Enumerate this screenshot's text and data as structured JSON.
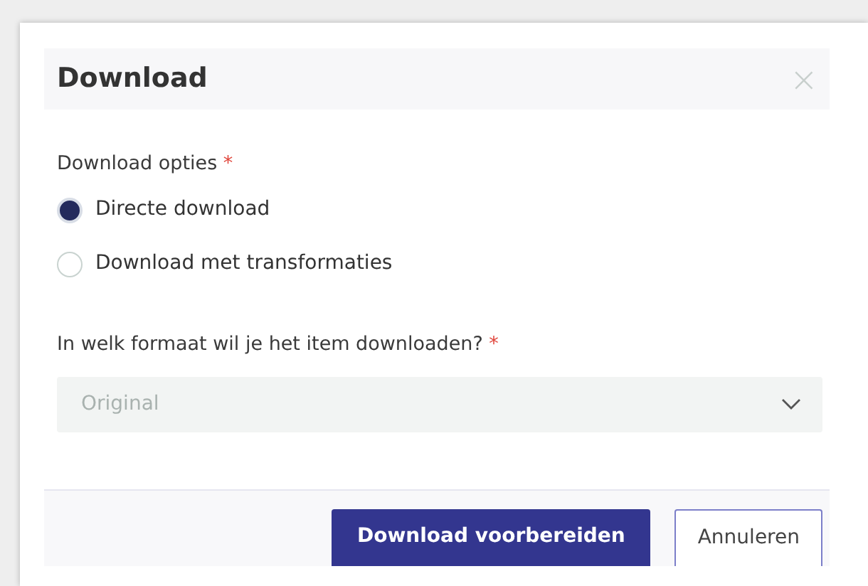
{
  "dialog": {
    "title": "Download",
    "close": "×"
  },
  "options": {
    "label": "Download opties",
    "required_mark": "*",
    "items": [
      {
        "label": "Directe download",
        "selected": true
      },
      {
        "label": "Download met transformaties",
        "selected": false
      }
    ]
  },
  "format": {
    "label": "In welk formaat wil je het item downloaden?",
    "required_mark": "*",
    "value": "Original",
    "disabled": true
  },
  "buttons": [
    {
      "label": "Download voorbereiden",
      "kind": "primary"
    },
    {
      "label": "Annuleren",
      "kind": "secondary"
    }
  ]
}
